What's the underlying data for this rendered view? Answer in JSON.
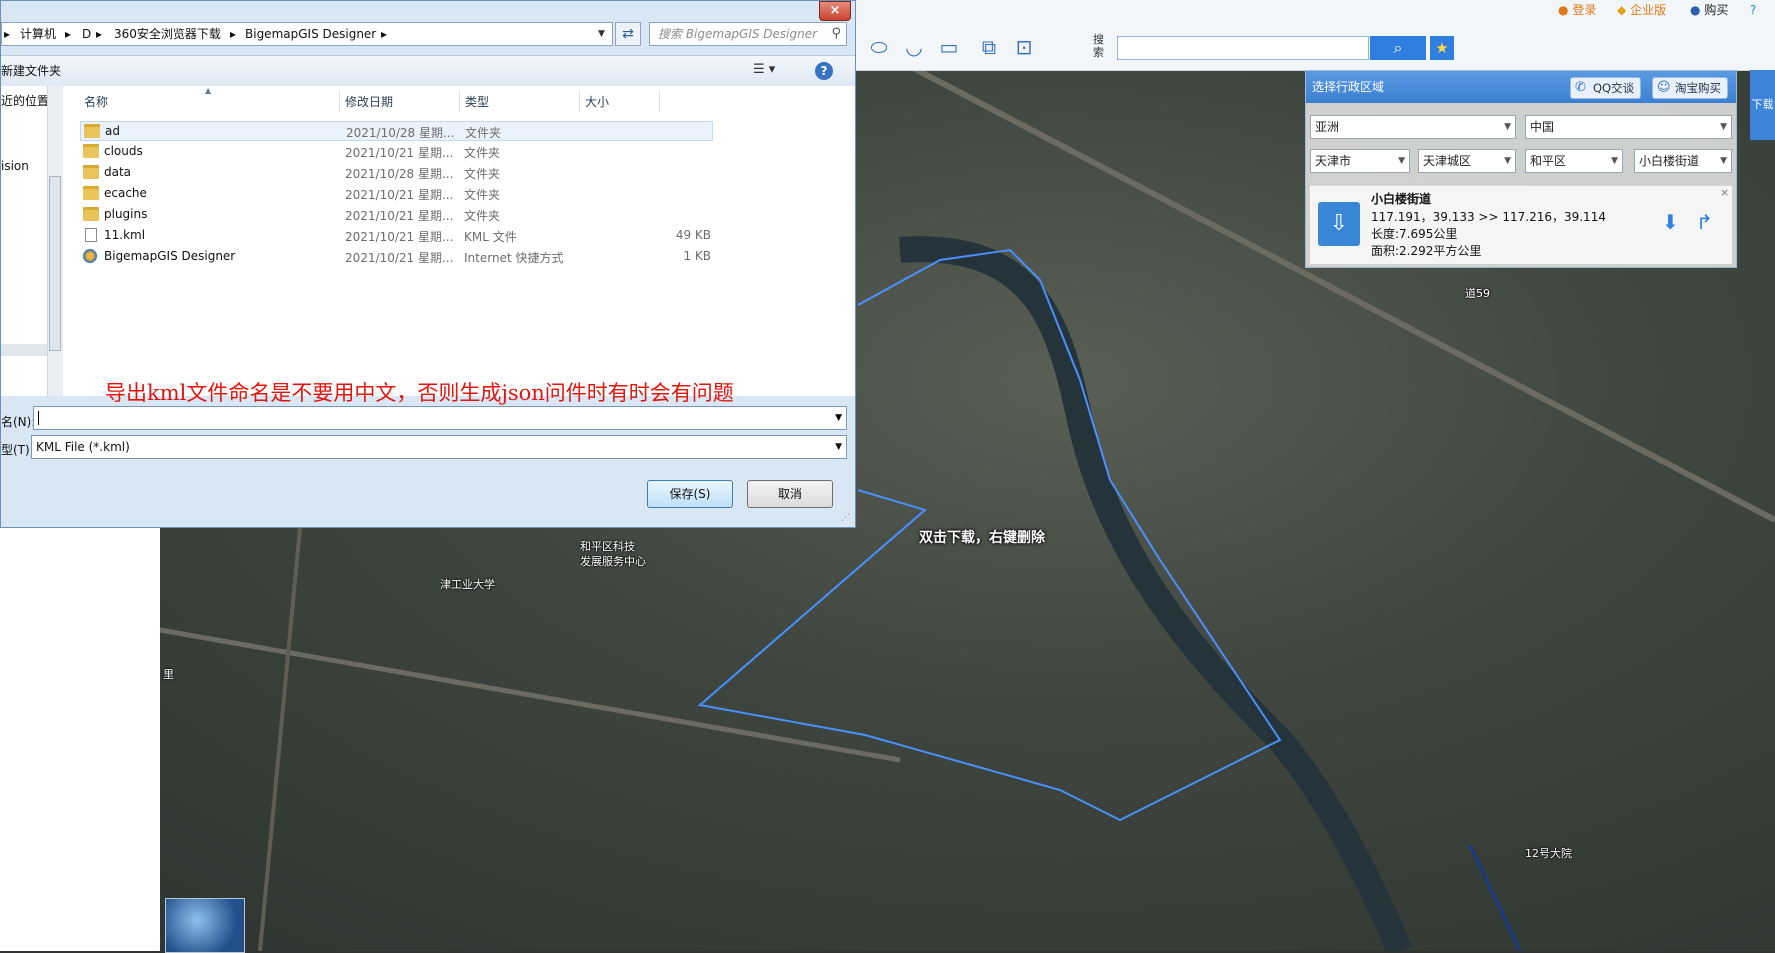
{
  "dialog": {
    "breadcrumbs": [
      "计算机",
      "D",
      "360安全浏览器下载",
      "BigemapGIS Designer"
    ],
    "search_placeholder": "搜索 BigemapGIS Designer",
    "new_folder": "新建文件夹",
    "nav_items": [
      "近的位置",
      "ision"
    ],
    "columns": {
      "name": "名称",
      "date": "修改日期",
      "type": "类型",
      "size": "大小"
    },
    "files": [
      {
        "name": "ad",
        "date": "2021/10/28 星期...",
        "type": "文件夹",
        "size": "",
        "kind": "folder"
      },
      {
        "name": "clouds",
        "date": "2021/10/21 星期...",
        "type": "文件夹",
        "size": "",
        "kind": "folder"
      },
      {
        "name": "data",
        "date": "2021/10/28 星期...",
        "type": "文件夹",
        "size": "",
        "kind": "folder"
      },
      {
        "name": "ecache",
        "date": "2021/10/21 星期...",
        "type": "文件夹",
        "size": "",
        "kind": "folder"
      },
      {
        "name": "plugins",
        "date": "2021/10/21 星期...",
        "type": "文件夹",
        "size": "",
        "kind": "folder"
      },
      {
        "name": "11.kml",
        "date": "2021/10/21 星期...",
        "type": "KML 文件",
        "size": "49 KB",
        "kind": "file"
      },
      {
        "name": "BigemapGIS Designer",
        "date": "2021/10/21 星期...",
        "type": "Internet 快捷方式",
        "size": "1 KB",
        "kind": "link"
      }
    ],
    "warning": "导出kml文件命名是不要用中文，否则生成json问件时有时会有问题",
    "filename_label": "名(N):",
    "filename_value": "",
    "filetype_label": "型(T):",
    "filetype_value": "KML File (*.kml)",
    "save_label": "保存(S)",
    "cancel_label": "取消"
  },
  "app": {
    "search_label": "搜索",
    "top_links": {
      "login": "登录",
      "enterprise": "企业版",
      "buy": "购买"
    },
    "admin_panel": {
      "title": "选择行政区域",
      "qq": "QQ交谈",
      "taobao": "淘宝购买",
      "continent": "亚洲",
      "country": "中国",
      "city": "天津市",
      "district_group": "天津城区",
      "district": "和平区",
      "street": "小白楼街道"
    },
    "info": {
      "name": "小白楼街道",
      "coords": "117.191，39.133 >> 117.216，39.114",
      "length": "长度:7.695公里",
      "area": "面积:2.292平方公里"
    },
    "side_tab": "下载"
  },
  "map": {
    "hint": "双击下载，右键删除",
    "labels": [
      "和平区科技",
      "发展服务中心",
      "津工业大学",
      "12号大院",
      "道59",
      "里"
    ]
  },
  "colors": {
    "accent": "#2f7ee0",
    "warning": "#e2150e",
    "boundary": "#4a90ff"
  }
}
